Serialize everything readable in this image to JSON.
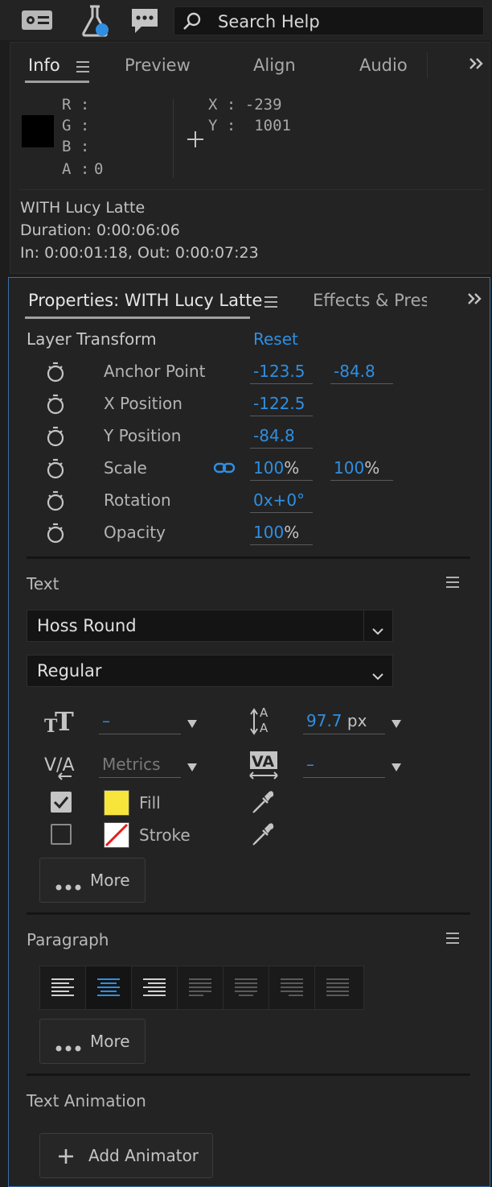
{
  "topbar": {
    "search_placeholder": "Search Help"
  },
  "info_panel": {
    "tabs": [
      "Info",
      "Preview",
      "Align",
      "Audio"
    ],
    "rgba": {
      "r_label": "R :",
      "g_label": "G :",
      "b_label": "B :",
      "a_label": "A :",
      "a_value": "0"
    },
    "coords": {
      "x_line": "X : -239",
      "y_line": "Y :  1001"
    },
    "layer_name": "WITH Lucy Latte",
    "duration": "Duration: 0:00:06:06",
    "in_out": "In: 0:00:01:18, Out: 0:00:07:23"
  },
  "properties_panel": {
    "tab_title": "Properties: WITH Lucy Latte",
    "other_tab": "Effects & Prese",
    "layer_transform": {
      "title": "Layer Transform",
      "reset_label": "Reset",
      "rows": [
        {
          "label": "Anchor Point",
          "v1": "-123.5",
          "v2": "-84.8"
        },
        {
          "label": "X Position",
          "v1": "-122.5"
        },
        {
          "label": "Y Position",
          "v1": "-84.8"
        },
        {
          "label": "Scale",
          "v1": "100",
          "u1": "%",
          "v2": "100",
          "u2": "%"
        },
        {
          "label": "Rotation",
          "v1": "0x+0°"
        },
        {
          "label": "Opacity",
          "v1": "100",
          "u1": "%"
        }
      ]
    },
    "text": {
      "title": "Text",
      "font_family": "Hoss Round",
      "font_style": "Regular",
      "font_size_value": "–",
      "leading_value": "97.7",
      "leading_unit": "px",
      "kerning_value": "Metrics",
      "tracking_value": "–",
      "fill_label": "Fill",
      "fill_checked": true,
      "fill_color": "#f7e53b",
      "stroke_label": "Stroke",
      "stroke_checked": false,
      "more_label": "More"
    },
    "paragraph": {
      "title": "Paragraph",
      "align_active": "center",
      "more_label": "More"
    },
    "text_animation": {
      "title": "Text Animation",
      "add_animator_label": "Add Animator"
    }
  },
  "colors": {
    "accent_blue": "#2e8fe2",
    "panel_border_focus": "#3a6ea8"
  }
}
